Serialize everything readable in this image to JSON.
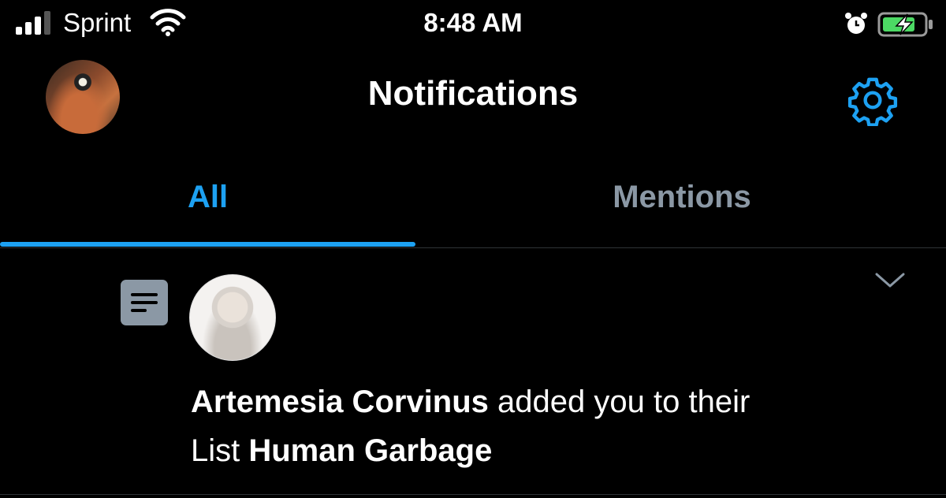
{
  "status_bar": {
    "carrier": "Sprint",
    "time": "8:48 AM",
    "icons": [
      "signal-icon",
      "wifi-icon",
      "alarm-icon",
      "battery-charging-icon"
    ],
    "battery_color": "#4cd964"
  },
  "header": {
    "title": "Notifications",
    "settings_icon": "gear-icon"
  },
  "tabs": [
    {
      "label": "All",
      "selected": true
    },
    {
      "label": "Mentions",
      "selected": false
    }
  ],
  "notification": {
    "icon": "list-icon",
    "user_name": "Artemesia Corvinus",
    "action_text": " added you to their",
    "object_prefix": "List ",
    "list_name": "Human Garbage"
  },
  "colors": {
    "accent": "#1da1f2",
    "inactive_tab": "#8b98a5",
    "background": "#000000",
    "divider": "#2f3336"
  }
}
